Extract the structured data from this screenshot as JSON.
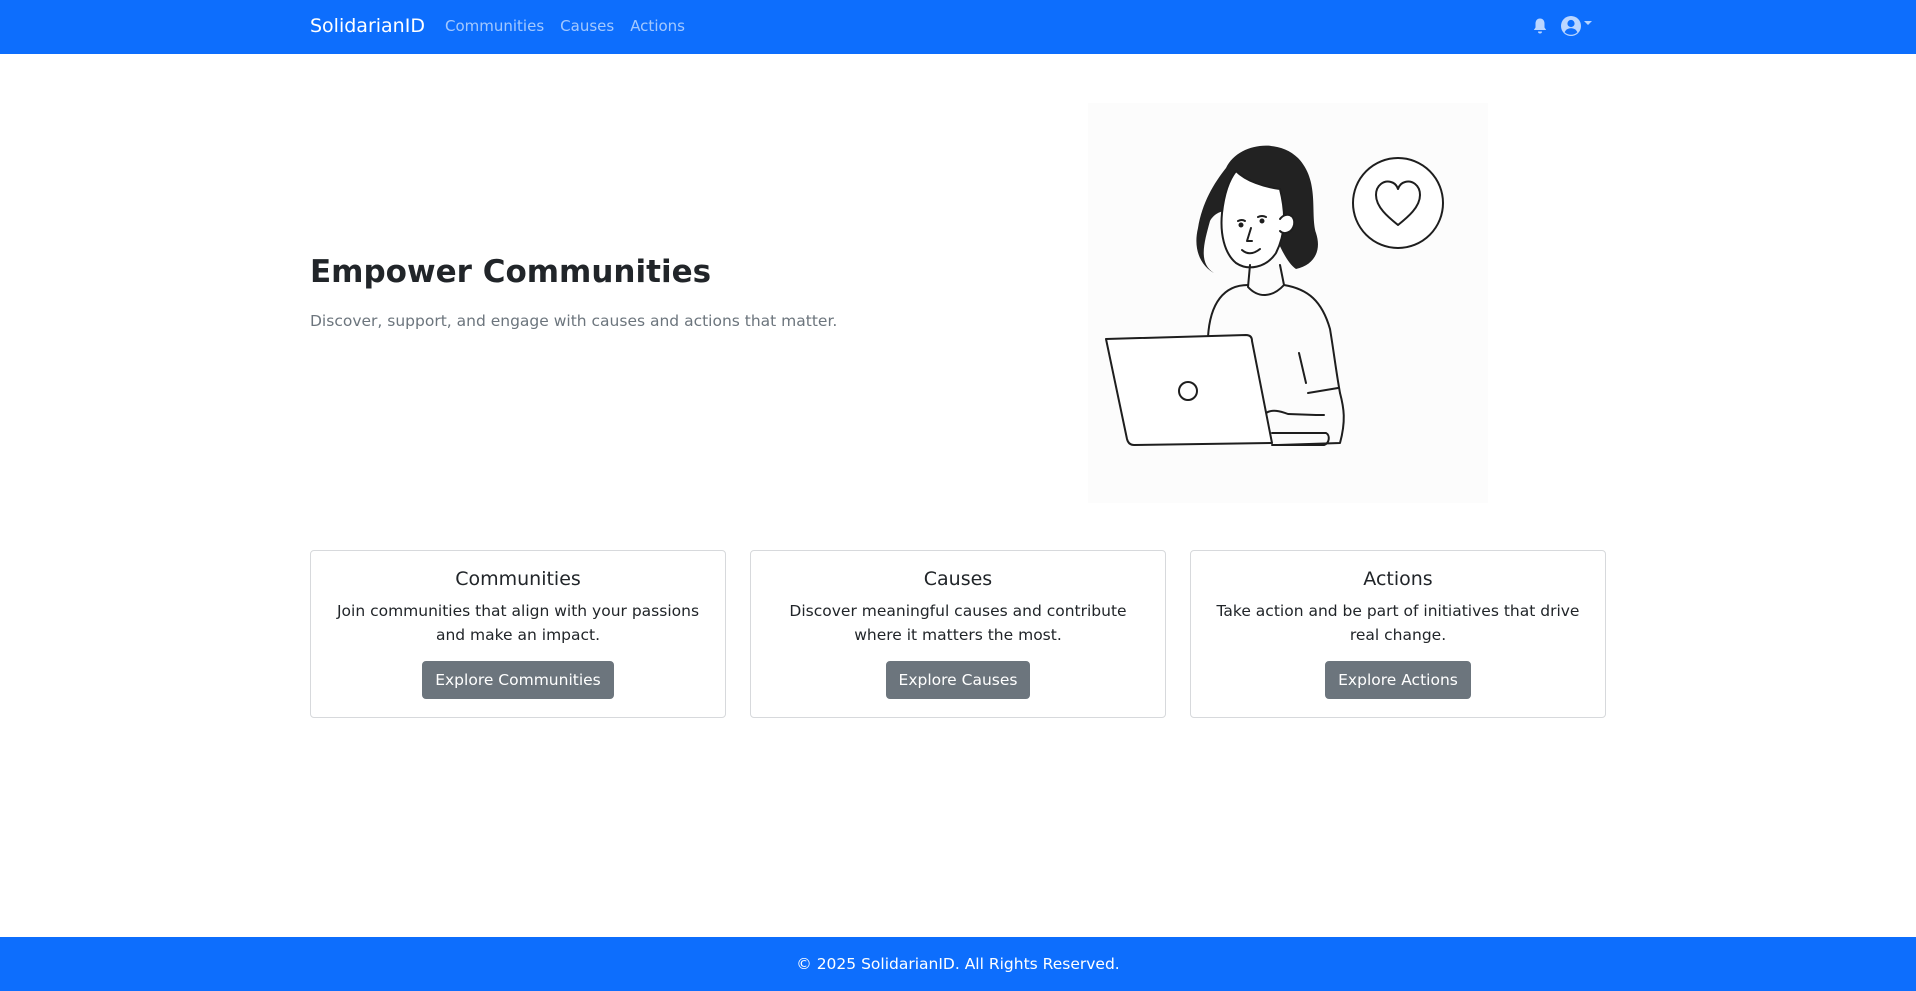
{
  "navbar": {
    "brand": "SolidarianID",
    "links": [
      "Communities",
      "Causes",
      "Actions"
    ],
    "icons": [
      "bell-icon",
      "user-circle-icon"
    ]
  },
  "hero": {
    "title": "Empower Communities",
    "subtitle": "Discover, support, and engage with causes and actions that matter."
  },
  "cards": [
    {
      "title": "Communities",
      "text": "Join communities that align with your passions and make an impact.",
      "button": "Explore Communities"
    },
    {
      "title": "Causes",
      "text": "Discover meaningful causes and contribute where it matters the most.",
      "button": "Explore Causes"
    },
    {
      "title": "Actions",
      "text": "Take action and be part of initiatives that drive real change.",
      "button": "Explore Actions"
    }
  ],
  "footer": {
    "text": "© 2025 SolidarianID. All Rights Reserved."
  },
  "colors": {
    "primary": "#0d6efd",
    "secondary_button": "#6c757d",
    "muted_text": "#6c757d"
  }
}
